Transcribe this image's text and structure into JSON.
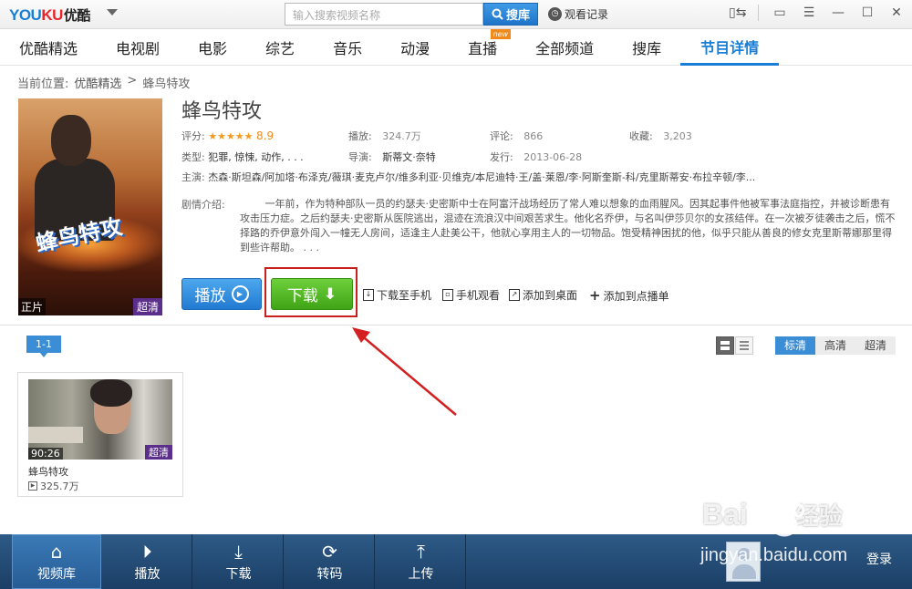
{
  "app": {
    "logo_en_a": "YOU",
    "logo_en_b": "KU",
    "logo_cn": "优酷"
  },
  "toolbar": {
    "search_placeholder": "输入搜索视频名称",
    "search_button": "搜库",
    "history": "观看记录"
  },
  "nav": {
    "items": [
      {
        "label": "优酷精选"
      },
      {
        "label": "电视剧"
      },
      {
        "label": "电影"
      },
      {
        "label": "综艺"
      },
      {
        "label": "音乐"
      },
      {
        "label": "动漫"
      },
      {
        "label": "直播",
        "badge": "new"
      },
      {
        "label": "全部频道"
      },
      {
        "label": "搜库"
      },
      {
        "label": "节目详情",
        "active": true
      }
    ]
  },
  "breadcrumb": {
    "prefix": "当前位置:",
    "home": "优酷精选",
    "separator": ">",
    "current": "蜂鸟特攻"
  },
  "poster": {
    "title": "蜂鸟特攻",
    "left_tag": "正片",
    "right_tag": "超清"
  },
  "movie": {
    "title": "蜂鸟特攻",
    "rating_label": "评分:",
    "rating_stars": "★★★★★",
    "rating": "8.9",
    "plays_label": "播放:",
    "plays": "324.7万",
    "comments_label": "评论:",
    "comments": "866",
    "favorites_label": "收藏:",
    "favorites": "3,203",
    "genre_label": "类型:",
    "genre": "犯罪, 惊悚, 动作, . . .",
    "director_label": "导演:",
    "director": "斯蒂文·奈特",
    "release_label": "发行:",
    "release": "2013-06-28",
    "cast_label": "主演:",
    "cast": "杰森·斯坦森/阿加塔·布泽克/薇琪·麦克卢尔/维多利亚·贝维克/本尼迪特·王/盖·莱恩/李·阿斯奎斯-科/克里斯蒂安·布拉辛顿/李...",
    "synopsis_label": "剧情介绍:",
    "synopsis": "一年前，作为特种部队一员的约瑟夫·史密斯中士在阿富汗战场经历了常人难以想象的血雨腥风。因其起事件他被军事法庭指控，并被诊断患有攻击压力症。之后约瑟夫·史密斯从医院逃出，混迹在流浪汉中间艰苦求生。他化名乔伊，与名叫伊莎贝尔的女孩结伴。在一次被歹徒袭击之后，慌不择路的乔伊意外闯入一幢无人房间，适逢主人赴美公干，他就心享用主人的一切物品。饱受精神困扰的他，似乎只能从善良的修女克里斯蒂娜那里得到些许帮助。 . . ."
  },
  "actions": {
    "play": "播放",
    "download": "下载",
    "download_phone": "下载至手机",
    "watch_phone": "手机观看",
    "add_desktop": "添加到桌面",
    "add_playlist": "添加到点播单"
  },
  "episodes": {
    "tab": "1-1",
    "qualities": [
      "标清",
      "高清",
      "超清"
    ],
    "active_quality": "标清",
    "items": [
      {
        "title": "蜂鸟特攻",
        "duration": "90:26",
        "quality": "超清",
        "plays": "325.7万"
      }
    ]
  },
  "bottombar": {
    "items": [
      {
        "label": "视频库",
        "icon": "home-icon",
        "active": true
      },
      {
        "label": "播放",
        "icon": "play-circle-icon"
      },
      {
        "label": "下载",
        "icon": "download-icon"
      },
      {
        "label": "转码",
        "icon": "refresh-icon"
      },
      {
        "label": "上传",
        "icon": "upload-icon"
      }
    ],
    "login": "登录"
  },
  "watermark": {
    "main": "Bai",
    "cn": "经验",
    "sub": "jingyan.baidu.com"
  },
  "colors": {
    "brand_blue": "#1a7fd4",
    "download_green": "#3fa416",
    "highlight_red": "#c9201d",
    "bottom_bar": "#1b3f66"
  }
}
